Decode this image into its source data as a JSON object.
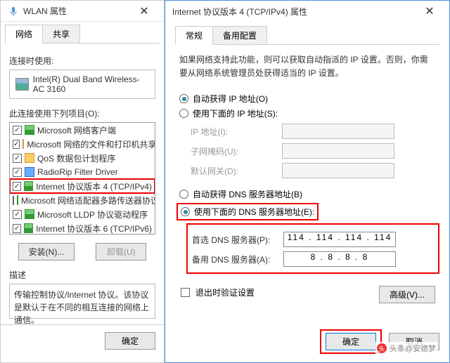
{
  "back": {
    "title": "WLAN 属性",
    "tabs": {
      "net": "网络",
      "share": "共享"
    },
    "connectUsing": "连接时使用:",
    "adapterName": "Intel(R) Dual Band Wireless-AC 3160",
    "listLabel": "此连接使用下列项目(O):",
    "items": [
      {
        "label": "Microsoft 网络客户端",
        "checked": true,
        "icon": "net"
      },
      {
        "label": "Microsoft 网络的文件和打印机共享",
        "checked": true,
        "icon": "file"
      },
      {
        "label": "QoS 数据包计划程序",
        "checked": true,
        "icon": "qos"
      },
      {
        "label": "RadioRip Filter Driver",
        "checked": true,
        "icon": "filter"
      },
      {
        "label": "Internet 协议版本 4 (TCP/IPv4)",
        "checked": true,
        "icon": "net",
        "highlighted": true
      },
      {
        "label": "Microsoft 网络适配器多路传送器协议",
        "checked": false,
        "icon": "net"
      },
      {
        "label": "Microsoft LLDP 协议驱动程序",
        "checked": true,
        "icon": "net"
      },
      {
        "label": "Internet 协议版本 6 (TCP/IPv6)",
        "checked": true,
        "icon": "net"
      }
    ],
    "installBtn": "安装(N)...",
    "uninstallBtn": "卸载(U)",
    "descLabel": "描述",
    "descText": "传输控制协议/Internet 协议。该协议是默认于在不同的相互连接的网络上通信。",
    "okBtn": "确定"
  },
  "front": {
    "title": "Internet 协议版本 4 (TCP/IPv4) 属性",
    "tabs": {
      "general": "常规",
      "alt": "备用配置"
    },
    "infoText": "如果网络支持此功能，则可以获取自动指派的 IP 设置。否则，你需要从网络系统管理员处获得适当的 IP 设置。",
    "ipAuto": "自动获得 IP 地址(O)",
    "ipManual": "使用下面的 IP 地址(S):",
    "ipAddrLabel": "IP 地址(I):",
    "subnetLabel": "子网掩码(U):",
    "gatewayLabel": "默认网关(D):",
    "dnsAuto": "自动获得 DNS 服务器地址(B)",
    "dnsManual": "使用下面的 DNS 服务器地址(E):",
    "prefDnsLabel": "首选 DNS 服务器(P):",
    "altDnsLabel": "备用 DNS 服务器(A):",
    "prefDnsValue": "114 . 114 . 114 . 114",
    "altDnsValue": "8  .  8  .  8  .  8",
    "exitValidate": "退出时验证设置",
    "advancedBtn": "高级(V)...",
    "okBtn": "确定",
    "cancelBtn": "取消"
  },
  "watermark": "头条@安德梦"
}
